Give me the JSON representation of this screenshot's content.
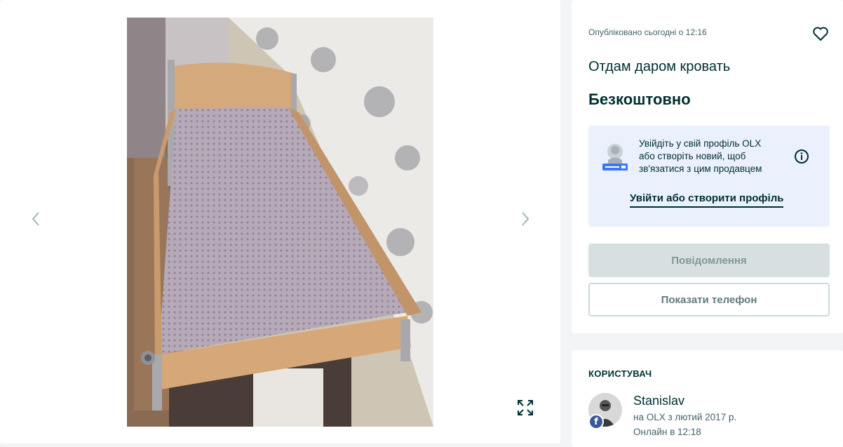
{
  "gallery": {
    "photo_alt": "",
    "icons": {
      "prev": "chevron-left-icon",
      "next": "chevron-right-icon",
      "expand": "expand-icon"
    }
  },
  "ad": {
    "published": "Опубліковано сьогодні о 12:16",
    "title": "Отдам даром кровать",
    "price": "Безкоштовно",
    "favorite_icon": "heart-icon"
  },
  "login_prompt": {
    "lines": [
      "Увійдіть у свій профіль OLX",
      "або створіть новий, щоб",
      "зв'язатися з цим продавцем"
    ],
    "link": "Увійти або створити профіль",
    "icons": {
      "illustration": "user-profile-icon",
      "info": "info-icon"
    }
  },
  "actions": {
    "message": "Повідомлення",
    "show_phone": "Показати телефон"
  },
  "user": {
    "heading": "КОРИСТУВАЧ",
    "name": "Stanislav",
    "since": "на OLX з лютий 2017 р.",
    "online": "Онлайн в 12:18",
    "social_badge": "f"
  },
  "colors": {
    "text": "#002f34",
    "login_box_bg": "#eaf0fc",
    "message_btn_bg": "#d8dfe0",
    "page_bg": "#f2f4f5"
  }
}
